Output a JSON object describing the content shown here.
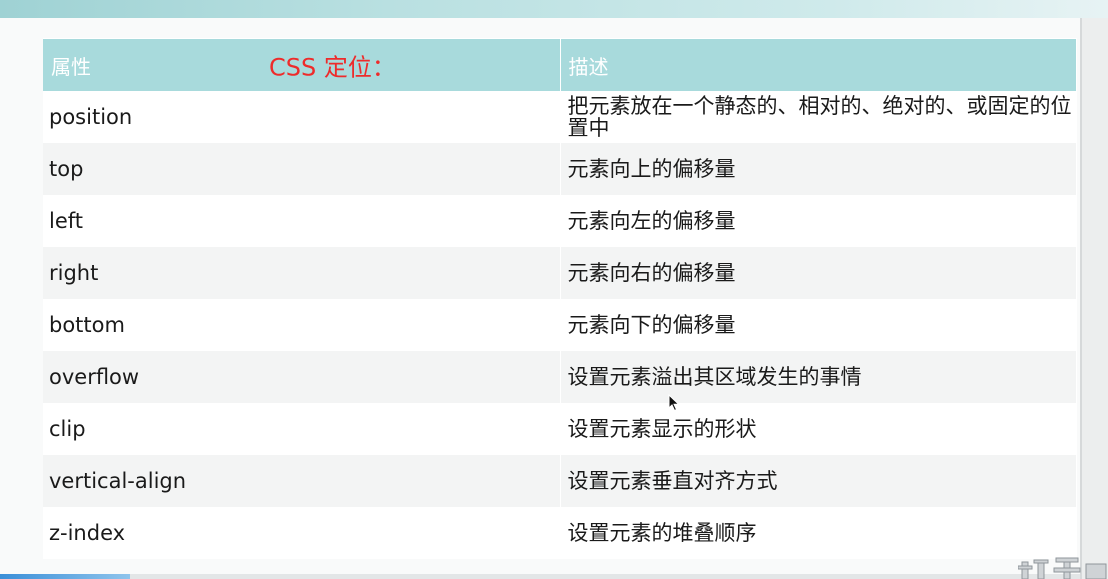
{
  "slide": {
    "heading": "CSS 定位："
  },
  "table": {
    "headers": [
      "属性",
      "描述"
    ],
    "rows": [
      {
        "property": "position",
        "description": "把元素放在一个静态的、相对的、绝对的、或固定的位置中"
      },
      {
        "property": "top",
        "description": "元素向上的偏移量"
      },
      {
        "property": "left",
        "description": "元素向左的偏移量"
      },
      {
        "property": "right",
        "description": "元素向右的偏移量"
      },
      {
        "property": "bottom",
        "description": "元素向下的偏移量"
      },
      {
        "property": "overflow",
        "description": "设置元素溢出其区域发生的事情"
      },
      {
        "property": "clip",
        "description": "设置元素显示的形状"
      },
      {
        "property": "vertical-align",
        "description": "设置元素垂直对齐方式"
      },
      {
        "property": "z-index",
        "description": "设置元素的堆叠顺序"
      }
    ]
  },
  "colors": {
    "header_bg": "#a8dadc",
    "heading_red": "#ee2b2b"
  },
  "icons": [
    "mouse-cursor-icon"
  ]
}
